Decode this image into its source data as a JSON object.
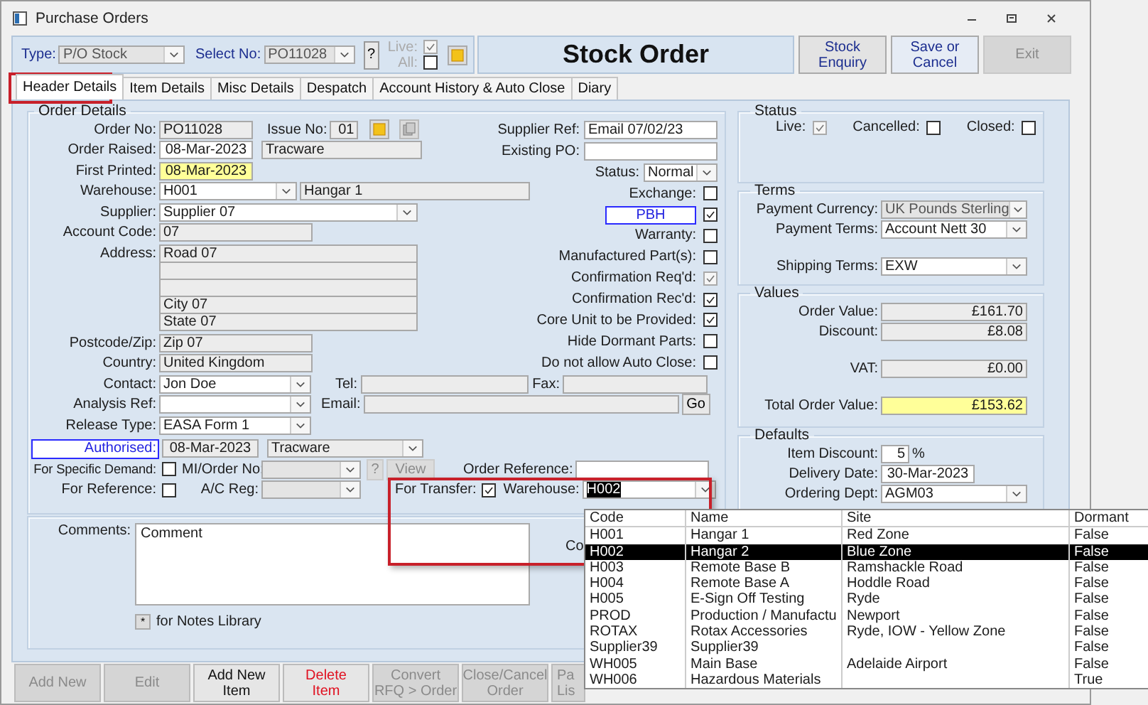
{
  "window": {
    "title": "Purchase Orders"
  },
  "toolbar": {
    "type_label": "Type:",
    "type_value": "P/O Stock",
    "select_label": "Select No:",
    "select_value": "PO11028",
    "help": "?",
    "live_label": "Live:",
    "live_checked": true,
    "all_label": "All:",
    "all_checked": false,
    "heading": "Stock Order",
    "buttons": [
      {
        "lines": [
          "Stock",
          "Enquiry"
        ],
        "disabled": false
      },
      {
        "lines": [
          "Save or",
          "Cancel"
        ],
        "disabled": false
      },
      {
        "lines": [
          "Exit"
        ],
        "disabled": true
      }
    ]
  },
  "tabs": [
    {
      "label": "Header Details",
      "selected": true
    },
    {
      "label": "Item Details",
      "selected": false
    },
    {
      "label": "Misc Details",
      "selected": false
    },
    {
      "label": "Despatch",
      "selected": false
    },
    {
      "label": "Account History & Auto Close",
      "selected": false
    },
    {
      "label": "Diary",
      "selected": false
    }
  ],
  "order_details": {
    "title": "Order Details",
    "order_no": {
      "label": "Order No:",
      "value": "PO11028"
    },
    "issue_no": {
      "label": "Issue No:",
      "value": "01"
    },
    "order_raised": {
      "label": "Order Raised:",
      "value": "08-Mar-2023",
      "by": "Tracware"
    },
    "first_printed": {
      "label": "First Printed:",
      "value": "08-Mar-2023"
    },
    "warehouse": {
      "label": "Warehouse:",
      "value": "H001",
      "name": "Hangar 1"
    },
    "supplier": {
      "label": "Supplier:",
      "value": "Supplier 07"
    },
    "account_code": {
      "label": "Account Code:",
      "value": "07"
    },
    "address": {
      "label": "Address:",
      "line_1": "Road 07",
      "line_4": "City 07",
      "line_5": "State 07"
    },
    "postcode": {
      "label": "Postcode/Zip:",
      "value": "Zip 07"
    },
    "country": {
      "label": "Country:",
      "value": "United Kingdom"
    },
    "supplier_ref": {
      "label": "Supplier Ref:",
      "value": "Email 07/02/23"
    },
    "existing_po": {
      "label": "Existing PO:"
    },
    "status": {
      "label": "Status:",
      "value": "Normal"
    },
    "flags": [
      {
        "kind": "flag",
        "label": "Exchange:",
        "checked": false,
        "disabled": false
      },
      {
        "kind": "tag",
        "label": "PBH",
        "checked": true,
        "disabled": false
      },
      {
        "kind": "flag",
        "label": "Warranty:",
        "checked": false,
        "disabled": false
      },
      {
        "kind": "flag",
        "label": "Manufactured Part(s):",
        "checked": false,
        "disabled": false
      },
      {
        "kind": "flag",
        "label": "Confirmation Req'd:",
        "checked": true,
        "disabled": true
      },
      {
        "kind": "flag",
        "label": "Confirmation Rec'd:",
        "checked": true,
        "disabled": false
      },
      {
        "kind": "flag",
        "label": "Core Unit to be Provided:",
        "checked": true,
        "disabled": false
      },
      {
        "kind": "flag",
        "label": "Hide Dormant Parts:",
        "checked": false,
        "disabled": false
      },
      {
        "kind": "flag",
        "label": "Do not allow Auto Close:",
        "checked": false,
        "disabled": false
      }
    ],
    "contact": {
      "label": "Contact:",
      "value": "Jon Doe"
    },
    "tel": {
      "label": "Tel:"
    },
    "fax": {
      "label": "Fax:"
    },
    "analysis_ref": {
      "label": "Analysis Ref:"
    },
    "email": {
      "label": "Email:"
    },
    "go": "Go",
    "release_type": {
      "label": "Release Type:",
      "value": "EASA Form 1"
    },
    "authorised": {
      "label": "Authorised:",
      "value": "08-Mar-2023",
      "by": "Tracware"
    },
    "specific_demand": {
      "label": "For Specific Demand:",
      "checked": false
    },
    "mi_order": {
      "label": "MI/Order No:"
    },
    "mi_help": "?",
    "view": "View",
    "order_reference": {
      "label": "Order Reference:"
    },
    "for_reference": {
      "label": "For Reference:",
      "checked": false
    },
    "ac_reg": {
      "label": "A/C Reg:"
    },
    "for_transfer": {
      "label": "For Transfer:",
      "checked": true
    },
    "transfer_warehouse": {
      "label": "Warehouse:",
      "value": "H002"
    }
  },
  "comments": {
    "label": "Comments:",
    "value": "Comment",
    "notes_key": "*",
    "notes_text": "for Notes Library",
    "cut_label": "Co"
  },
  "status_group": {
    "title": "Status",
    "items": [
      {
        "label": "Live:",
        "checked": true,
        "disabled": true
      },
      {
        "label": "Cancelled:",
        "checked": false,
        "disabled": false
      },
      {
        "label": "Closed:",
        "checked": false,
        "disabled": false
      }
    ]
  },
  "terms": {
    "title": "Terms",
    "rows": [
      {
        "label": "Payment Currency:",
        "value": "UK Pounds Sterling",
        "disabled": true
      },
      {
        "label": "Payment Terms:",
        "value": "Account Nett 30",
        "disabled": false
      },
      {
        "label": "Shipping Terms:",
        "value": "EXW",
        "disabled": false
      }
    ]
  },
  "values": {
    "title": "Values",
    "rows": [
      {
        "label": "Order Value:",
        "value": "£161.70",
        "highlight": false
      },
      {
        "label": "Discount:",
        "value": "£8.08",
        "highlight": false
      },
      {
        "label": "VAT:",
        "value": "£0.00",
        "highlight": false
      },
      {
        "label": "Total Order Value:",
        "value": "£153.62",
        "highlight": true
      }
    ]
  },
  "defaults": {
    "title": "Defaults",
    "item_discount": {
      "label": "Item Discount:",
      "value": "5",
      "unit": "%"
    },
    "delivery_date": {
      "label": "Delivery Date:",
      "value": "30-Mar-2023"
    },
    "ordering_dept": {
      "label": "Ordering Dept:",
      "value": "AGM03"
    }
  },
  "bottom_buttons": [
    {
      "kind": "normal",
      "lines": [
        "Add New"
      ],
      "disabled": true
    },
    {
      "kind": "normal",
      "lines": [
        "Edit"
      ],
      "disabled": true
    },
    {
      "kind": "normal",
      "lines": [
        "Add New",
        "Item"
      ],
      "disabled": false
    },
    {
      "kind": "delete",
      "lines": [
        "Delete",
        "Item"
      ],
      "disabled": false
    },
    {
      "kind": "normal",
      "lines": [
        "Convert",
        "RFQ > Order"
      ],
      "disabled": true
    },
    {
      "kind": "normal",
      "lines": [
        "Close/Cancel",
        "Order"
      ],
      "disabled": true
    },
    {
      "kind": "cut",
      "lines": [
        "Pa",
        "Lis"
      ],
      "disabled": true
    }
  ],
  "warehouse_list": {
    "columns": [
      "Code",
      "Name",
      "Site",
      "Dormant"
    ],
    "rows": [
      {
        "cells": [
          "H001",
          "Hangar 1",
          "Red Zone",
          "False"
        ],
        "selected": false
      },
      {
        "cells": [
          "H002",
          "Hangar 2",
          "Blue Zone",
          "False"
        ],
        "selected": true
      },
      {
        "cells": [
          "H003",
          "Remote Base B",
          "Ramshackle Road",
          "False"
        ],
        "selected": false
      },
      {
        "cells": [
          "H004",
          "Remote Base A",
          "Hoddle Road",
          "False"
        ],
        "selected": false
      },
      {
        "cells": [
          "H005",
          "E-Sign Off Testing",
          "Ryde",
          "False"
        ],
        "selected": false
      },
      {
        "cells": [
          "PROD",
          "Production / Manufactu",
          "Newport",
          "False"
        ],
        "selected": false
      },
      {
        "cells": [
          "ROTAX",
          "Rotax Accessories",
          "Ryde, IOW - Yellow Zone",
          "False"
        ],
        "selected": false
      },
      {
        "cells": [
          "Supplier39",
          "Supplier39",
          null,
          "False"
        ],
        "selected": false
      },
      {
        "cells": [
          "WH005",
          "Main Base",
          "Adelaide Airport",
          "False"
        ],
        "selected": false
      },
      {
        "cells": [
          "WH006",
          "Hazardous Materials",
          null,
          "True"
        ],
        "selected": false
      }
    ]
  }
}
